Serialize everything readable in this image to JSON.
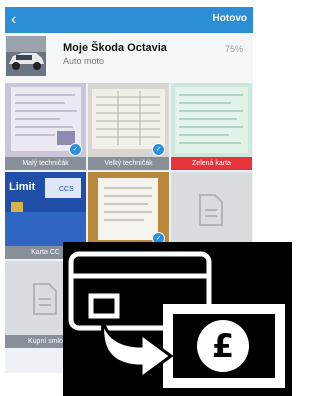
{
  "navbar": {
    "back_icon": "chevron-left-icon",
    "back_glyph": "‹",
    "done_label": "Hotovo",
    "color": "#2c8fd6"
  },
  "header": {
    "title": "Moje Škoda Octavia",
    "subtitle": "Auto moto",
    "progress_text": "75%"
  },
  "tiles": [
    {
      "label": "Malý techničák",
      "checked": true,
      "highlight": false
    },
    {
      "label": "Velký techničák",
      "checked": true,
      "highlight": false
    },
    {
      "label": "Zelená karta",
      "checked": false,
      "highlight": true,
      "highlight_color": "#e8333b"
    },
    {
      "label": "Karta CC",
      "checked": false,
      "highlight": false
    },
    {
      "label": "",
      "checked": true,
      "highlight": false
    },
    {
      "label": "",
      "checked": false,
      "highlight": false
    },
    {
      "label": "Kupní smlo",
      "checked": false,
      "highlight": false
    }
  ],
  "card_image_text": "Limit",
  "card_badge": "CCS",
  "overlay": {
    "icon": "card-to-pound-payment-icon",
    "symbol": "£"
  }
}
